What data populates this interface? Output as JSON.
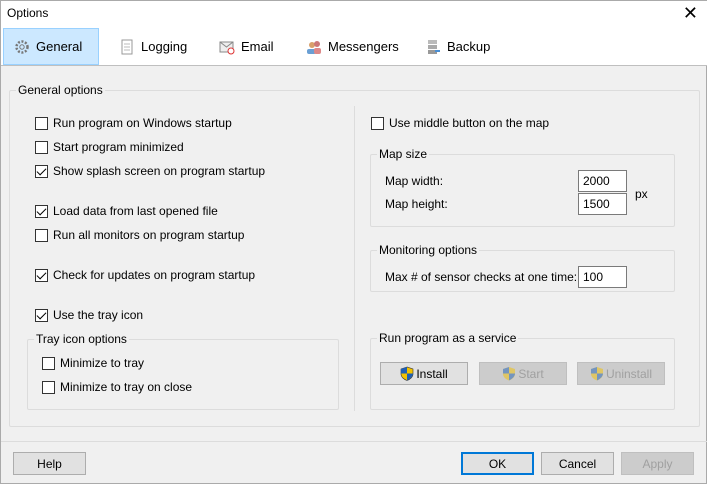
{
  "window": {
    "title": "Options",
    "close": "✕"
  },
  "tabs": [
    {
      "label": "General",
      "icon": "gear-icon"
    },
    {
      "label": "Logging",
      "icon": "document-icon"
    },
    {
      "label": "Email",
      "icon": "email-icon"
    },
    {
      "label": "Messengers",
      "icon": "users-icon"
    },
    {
      "label": "Backup",
      "icon": "server-icon"
    }
  ],
  "general": {
    "group_label": "General options",
    "options": [
      {
        "label": "Run program on Windows startup",
        "checked": false
      },
      {
        "label": "Start program minimized",
        "checked": false
      },
      {
        "label": "Show splash screen on program startup",
        "checked": true
      },
      {
        "label": "Load data from last opened file",
        "checked": true
      },
      {
        "label": "Run all monitors on program startup",
        "checked": false
      },
      {
        "label": "Check for updates on program startup",
        "checked": true
      },
      {
        "label": "Use the tray icon",
        "checked": true
      }
    ],
    "tray": {
      "label": "Tray icon options",
      "options": [
        {
          "label": "Minimize to tray",
          "checked": false
        },
        {
          "label": "Minimize to tray on close",
          "checked": false
        }
      ]
    },
    "middle_button": {
      "label": "Use middle button on the map",
      "checked": false
    },
    "map_size": {
      "label": "Map size",
      "width_label": "Map width:",
      "width": "2000",
      "height_label": "Map height:",
      "height": "1500",
      "unit": "px"
    },
    "monitoring": {
      "label": "Monitoring options",
      "max_label": "Max # of sensor checks at one time:",
      "max": "100"
    },
    "service": {
      "label": "Run program as a service",
      "install": "Install",
      "start": "Start",
      "uninstall": "Uninstall"
    }
  },
  "footer": {
    "help": "Help",
    "ok": "OK",
    "cancel": "Cancel",
    "apply": "Apply"
  }
}
